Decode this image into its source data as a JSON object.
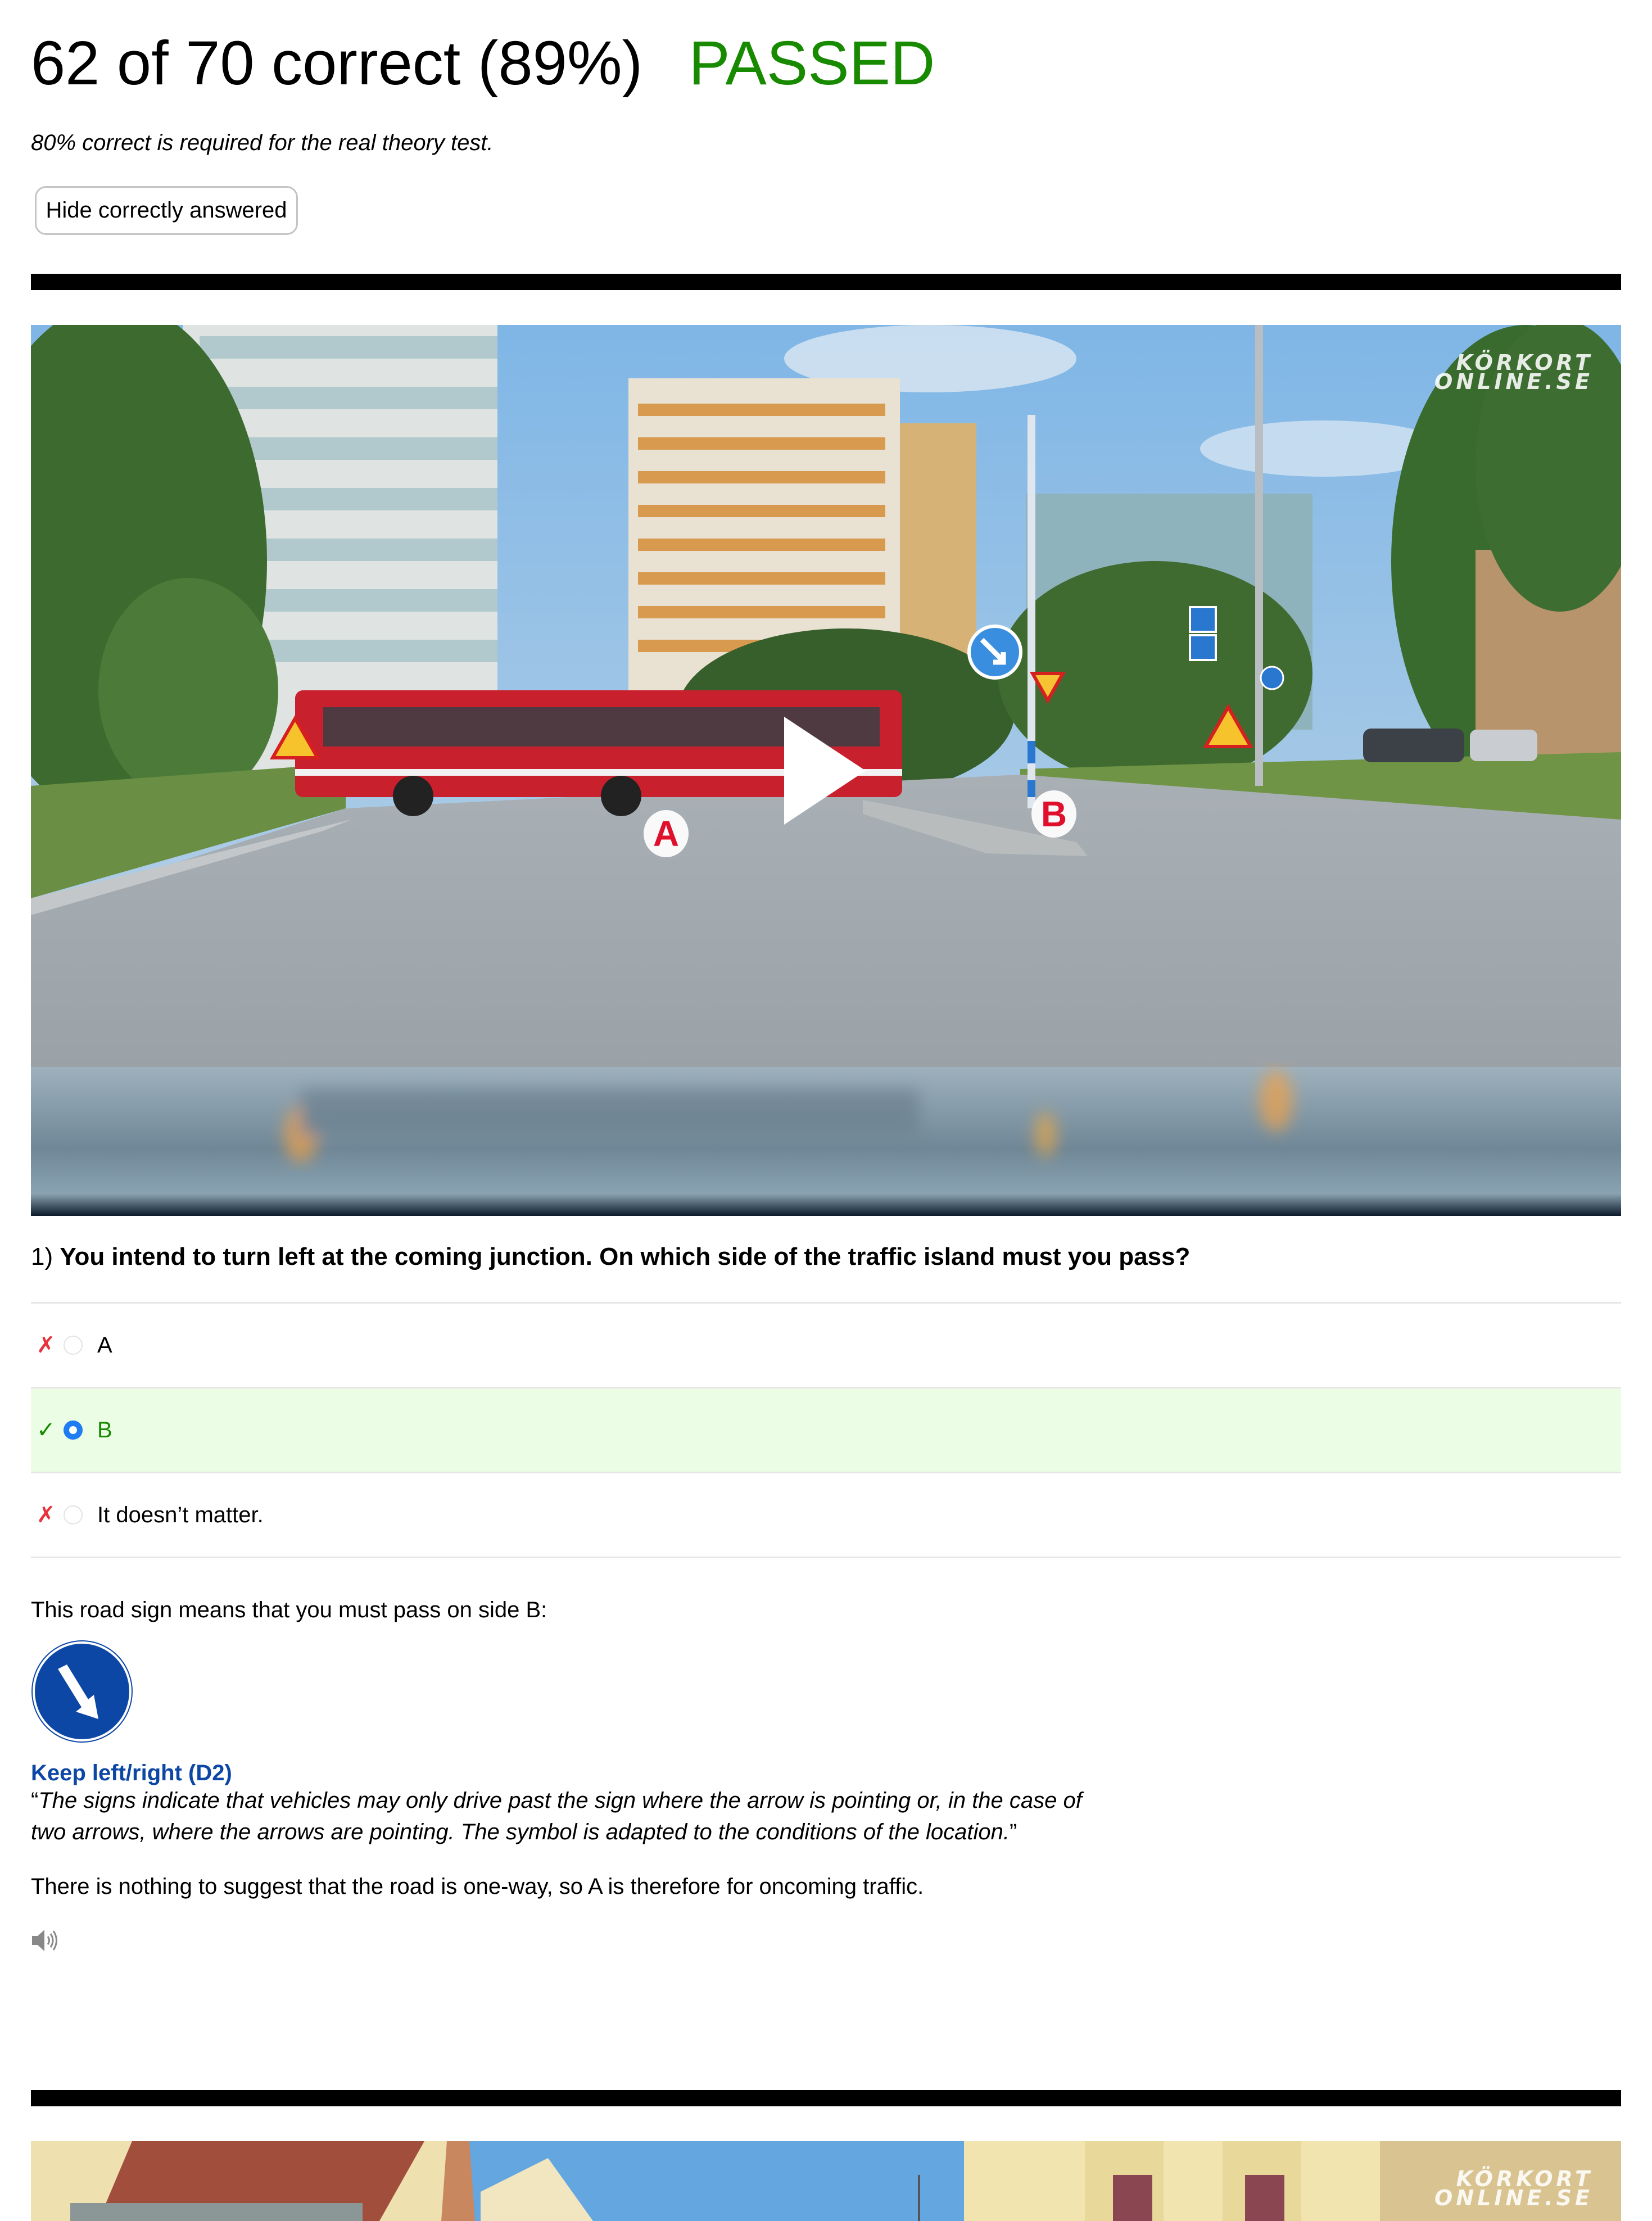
{
  "result": {
    "score_text": "62 of 70 correct (89%)",
    "status": "PASSED",
    "status_color": "#178a00",
    "requirement_text": "80% correct is required for the real theory test.",
    "hide_button_label": "Hide correctly answered"
  },
  "questions": [
    {
      "number": "1)",
      "text": "You intend to turn left at the coming junction. On which side of the traffic island must you pass?",
      "media": {
        "type": "video",
        "watermark_line1": "KÖRKORT",
        "watermark_line2": "ONLINE.SE",
        "labels": [
          "A",
          "B"
        ],
        "play_icon": "play-icon"
      },
      "answers": [
        {
          "mark": "✗",
          "mark_state": "wrong",
          "selected": false,
          "correct": false,
          "text": "A"
        },
        {
          "mark": "✓",
          "mark_state": "right",
          "selected": true,
          "correct": true,
          "text": "B"
        },
        {
          "mark": "✗",
          "mark_state": "wrong",
          "selected": false,
          "correct": false,
          "text": "It doesn’t matter."
        }
      ],
      "explanation": {
        "intro": "This road sign means that you must pass on side B:",
        "sign_icon": "keep-right-sign-icon",
        "sign_title": "Keep left/right (D2)",
        "quote_open": "“",
        "quote_body": "The signs indicate that vehicles may only drive past the sign where the arrow is pointing or, in the case of two arrows, where the arrows are pointing. The symbol is adapted to the conditions of the location.",
        "quote_close": "”",
        "note": "There is nothing to suggest that the road is one-way, so A is therefore for oncoming traffic.",
        "audio_icon": "speaker-icon"
      }
    },
    {
      "media": {
        "type": "image",
        "watermark_line1": "KÖRKORT",
        "watermark_line2": "ONLINE.SE"
      }
    }
  ],
  "colors": {
    "correct_bg": "#ebfde4",
    "correct_text": "#178a00",
    "wrong_mark": "#e8323c",
    "radio_checked": "#1f7cf3",
    "sign_blue": "#0d47a6"
  }
}
